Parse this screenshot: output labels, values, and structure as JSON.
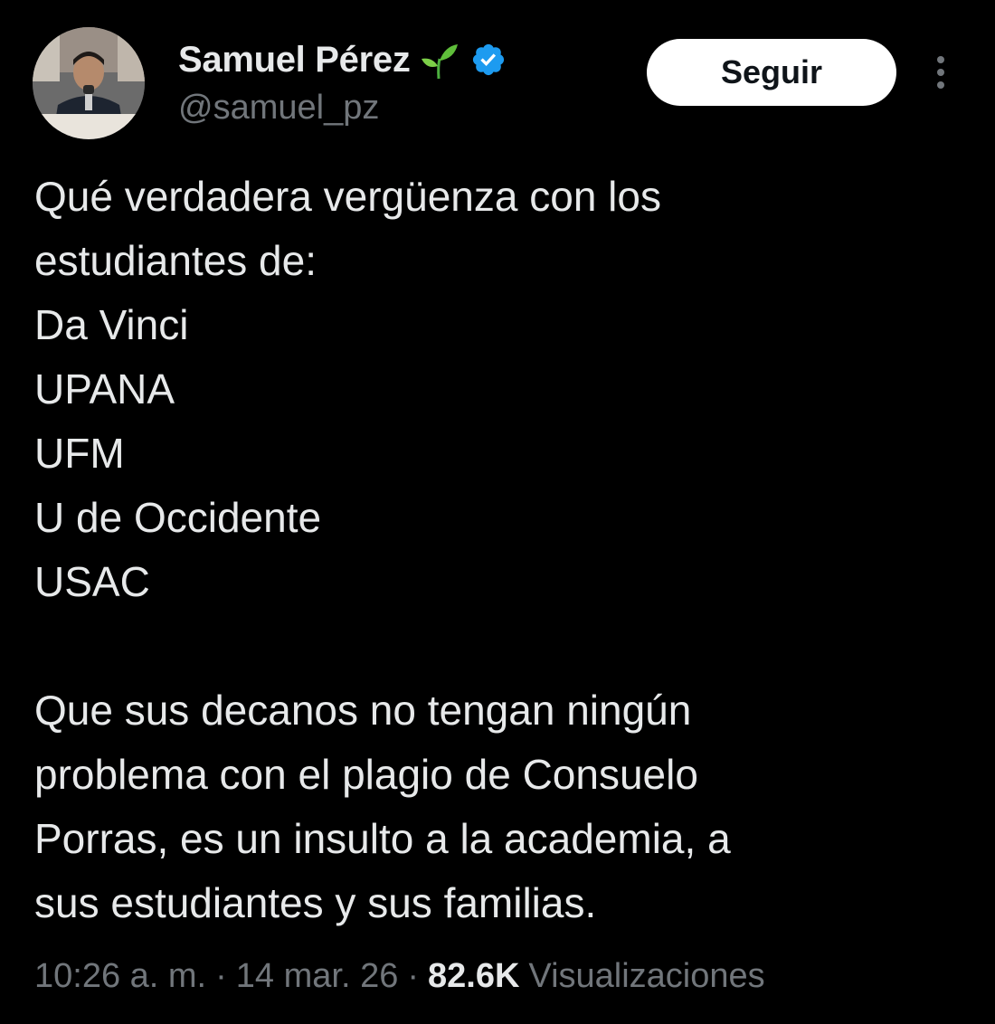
{
  "author": {
    "display_name": "Samuel Pérez",
    "handle": "@samuel_pz",
    "name_emoji": "sprout-icon",
    "verified_badge": "verified-icon",
    "verified_color": "#1d9bf0"
  },
  "actions": {
    "follow_label": "Seguir",
    "more_icon": "more-vertical-icon"
  },
  "tweet": {
    "lines": [
      "Qué verdadera vergüenza con los",
      "estudiantes de:",
      "Da Vinci",
      "UPANA",
      "UFM",
      "U de Occidente",
      "USAC",
      "",
      "Que sus decanos no tengan ningún",
      "problema con el plagio de Consuelo",
      "Porras, es un insulto a la academia, a",
      "sus estudiantes y sus familias."
    ]
  },
  "meta": {
    "time": "10:26 a. m.",
    "separator": "·",
    "date": "14 mar. 26",
    "views_count": "82.6K",
    "views_label": "Visualizaciones"
  },
  "colors": {
    "background": "#000000",
    "text_primary": "#e7e9ea",
    "text_secondary": "#71767b",
    "button_bg": "#ffffff",
    "button_text": "#0f1419"
  }
}
